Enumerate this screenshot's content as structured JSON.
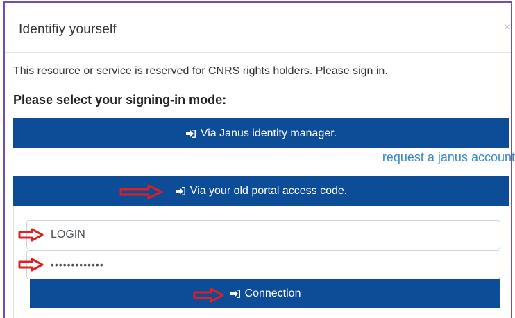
{
  "modal": {
    "title": "Identifiy yourself",
    "close_symbol": "×"
  },
  "intro_text": "This resource or service is reserved for CNRS rights holders. Please sign in.",
  "select_mode_text": "Please select your signing-in mode:",
  "janus_button": {
    "label": "Via Janus identity manager.",
    "icon": "sign-in-icon"
  },
  "request_link": "request a janus account",
  "old_portal_button": {
    "label": "Via your old portal access code.",
    "icon": "sign-in-icon"
  },
  "login_field": {
    "value": "LOGIN"
  },
  "password_field": {
    "value": "•••••••••••••"
  },
  "connection_button": {
    "label": "Connection",
    "icon": "sign-in-icon"
  },
  "colors": {
    "primary": "#0d4c97",
    "link": "#3a87c4",
    "annotation_arrow": "#e02020",
    "frame": "#6b4fbb"
  }
}
